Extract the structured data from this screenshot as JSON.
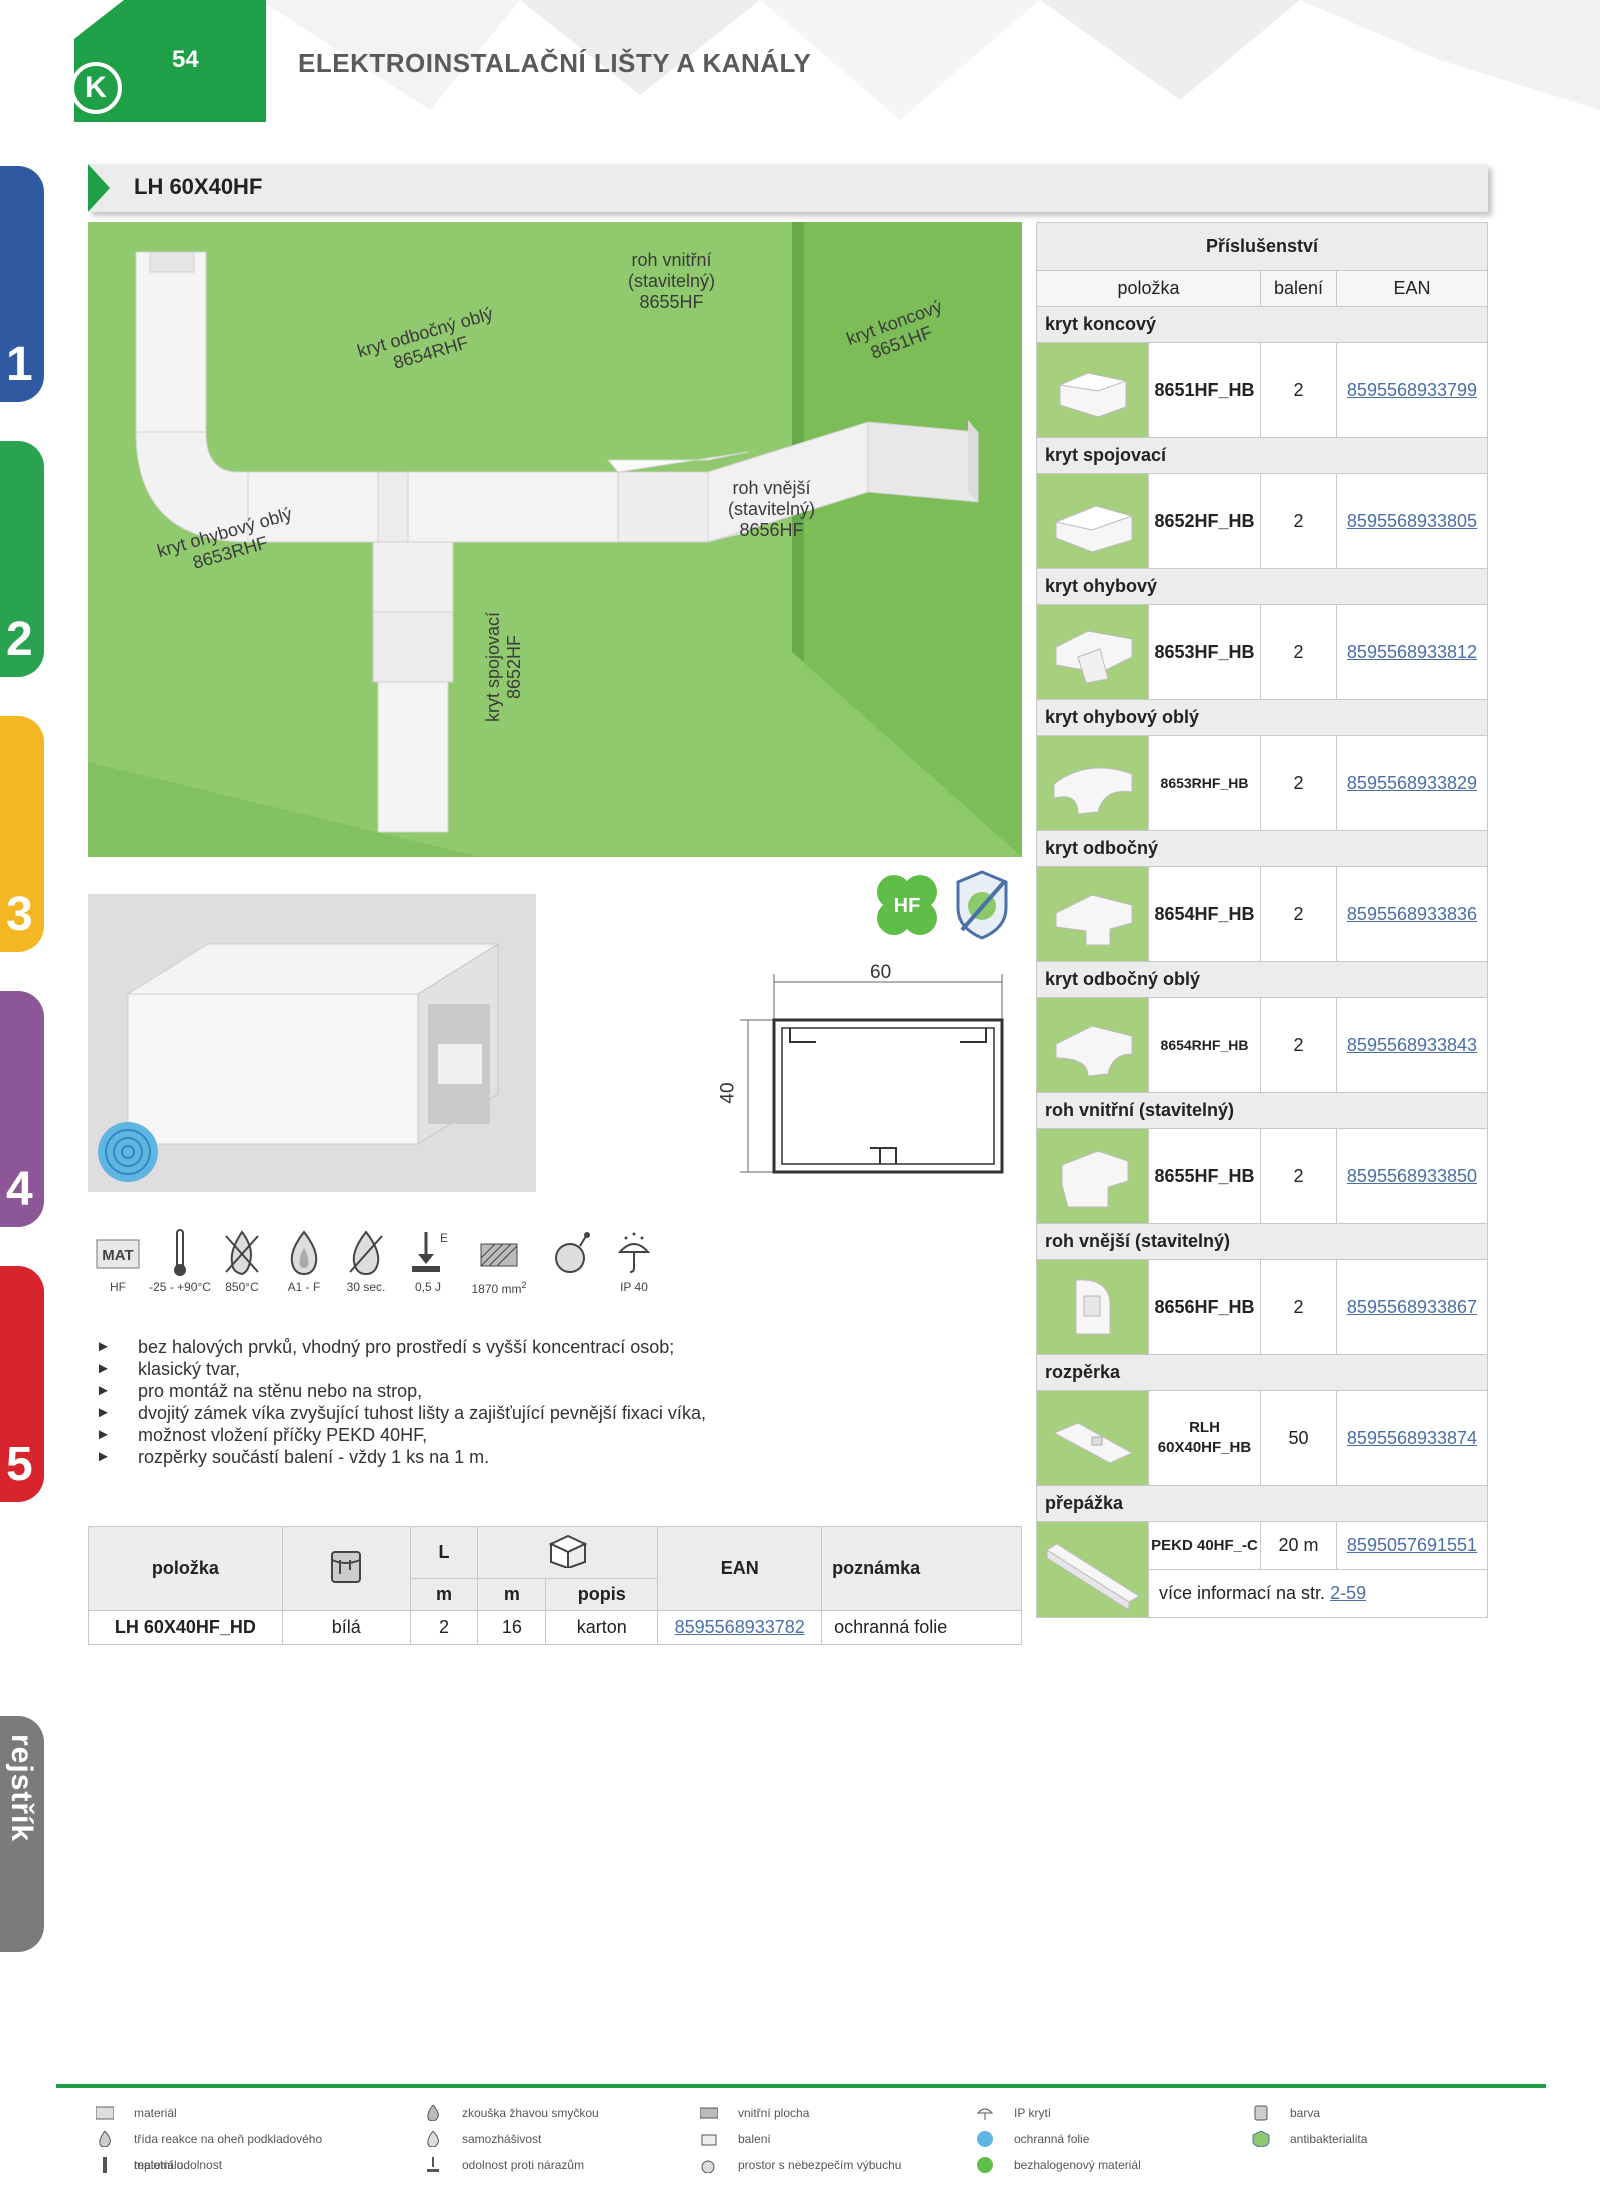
{
  "header": {
    "page_number": "54",
    "title": "ELEKTROINSTALAČNÍ LIŠTY A KANÁLY",
    "logo": "K"
  },
  "side_tabs": [
    {
      "label": "1",
      "color": "#2f5aa2"
    },
    {
      "label": "2",
      "color": "#2aa350"
    },
    {
      "label": "3",
      "color": "#f2b722"
    },
    {
      "label": "4",
      "color": "#8d5697"
    },
    {
      "label": "5",
      "color": "#d8252d"
    }
  ],
  "index_tab": {
    "label": "rejstřík"
  },
  "product": {
    "title": "LH 60X40HF"
  },
  "hero_labels": {
    "roh_vnitrni": [
      "roh vnitřní",
      "(stavitelný)",
      "8655HF"
    ],
    "kryt_odbocny_obly": [
      "kryt odbočný oblý",
      "8654RHF"
    ],
    "kryt_koncovy": [
      "kryt koncový",
      "8651HF"
    ],
    "kryt_ohybovy_obly": [
      "kryt ohybový oblý",
      "8653RHF"
    ],
    "roh_vnejsi": [
      "roh vnější",
      "(stavitelný)",
      "8656HF"
    ],
    "kryt_spojovaci": [
      "kryt spojovací",
      "8652HF"
    ]
  },
  "badges": {
    "hf": "HF"
  },
  "dimensions": {
    "width": "60",
    "height": "40"
  },
  "properties": [
    {
      "icon": "MAT",
      "value": "HF"
    },
    {
      "icon": "thermometer-icon",
      "value": "-25 - +90°C"
    },
    {
      "icon": "glow-wire-icon",
      "value": "850°C"
    },
    {
      "icon": "flame-icon",
      "value": "A1 - F"
    },
    {
      "icon": "self-extinguish-icon",
      "value": "30 sec."
    },
    {
      "icon": "impact-icon",
      "value": "0,5 J",
      "sup": "E"
    },
    {
      "icon": "cross-section-icon",
      "value": "1870 mm",
      "unit_sup": "2"
    },
    {
      "icon": "explosion-icon",
      "value": ""
    },
    {
      "icon": "ip-icon",
      "value": "IP 40"
    }
  ],
  "bullets": [
    "bez halových prvků, vhodný pro prostředí s vyšší koncentrací osob;",
    "klasický tvar,",
    "pro montáž na stěnu nebo na strop,",
    "dvojitý zámek víka zvyšující tuhost lišty a zajišťující pevnější fixaci víka,",
    "možnost vložení příčky PEKD 40HF,",
    "rozpěrky součástí balení - vždy 1 ks na 1 m."
  ],
  "main_table": {
    "headers": {
      "item": "položka",
      "length": "L",
      "ean": "EAN",
      "note": "poznámka",
      "m1": "m",
      "m2": "m",
      "desc": "popis"
    },
    "rows": [
      {
        "item": "LH 60X40HF_HD",
        "color": "bílá",
        "length": "2",
        "pack": "16",
        "desc": "karton",
        "ean": "8595568933782",
        "note": "ochranná folie"
      }
    ]
  },
  "accessories": {
    "title": "Příslušenství",
    "col_item": "položka",
    "col_pack": "balení",
    "col_ean": "EAN",
    "groups": [
      {
        "name": "kryt koncový",
        "code": "8651HF_HB",
        "pack": "2",
        "ean": "8595568933799"
      },
      {
        "name": "kryt spojovací",
        "code": "8652HF_HB",
        "pack": "2",
        "ean": "8595568933805"
      },
      {
        "name": "kryt ohybový",
        "code": "8653HF_HB",
        "pack": "2",
        "ean": "8595568933812"
      },
      {
        "name": "kryt ohybový oblý",
        "code": "8653RHF_HB",
        "pack": "2",
        "ean": "8595568933829"
      },
      {
        "name": "kryt odbočný",
        "code": "8654HF_HB",
        "pack": "2",
        "ean": "8595568933836"
      },
      {
        "name": "kryt odbočný oblý",
        "code": "8654RHF_HB",
        "pack": "2",
        "ean": "8595568933843"
      },
      {
        "name": "roh vnitřní (stavitelný)",
        "code": "8655HF_HB",
        "pack": "2",
        "ean": "8595568933850"
      },
      {
        "name": "roh vnější (stavitelný)",
        "code": "8656HF_HB",
        "pack": "2",
        "ean": "8595568933867"
      },
      {
        "name": "rozpěrka",
        "code": "RLH 60X40HF_HB",
        "pack": "50",
        "ean": "8595568933874"
      }
    ],
    "last": {
      "name": "přepážka",
      "code": "PEKD 40HF_-C",
      "pack": "20 m",
      "ean": "8595057691551",
      "info_prefix": "více informací na str.",
      "info_link": "2-59"
    }
  },
  "legend": [
    [
      "materiál",
      "třída reakce na oheň podkladového materiálu",
      "teplotní odolnost"
    ],
    [
      "zkouška žhavou smyčkou",
      "samozhášivost",
      "odolnost proti nárazům"
    ],
    [
      "vnitřní plocha",
      "balení",
      "prostor s nebezpečím výbuchu"
    ],
    [
      "IP krytí",
      "ochranná folie",
      "bezhalogenový materiál"
    ],
    [
      "barva",
      "antibakterialita"
    ]
  ],
  "colors": {
    "brand_green": "#1e9f48",
    "wall_green": "#8dc86a",
    "link": "#4a6ea8"
  }
}
